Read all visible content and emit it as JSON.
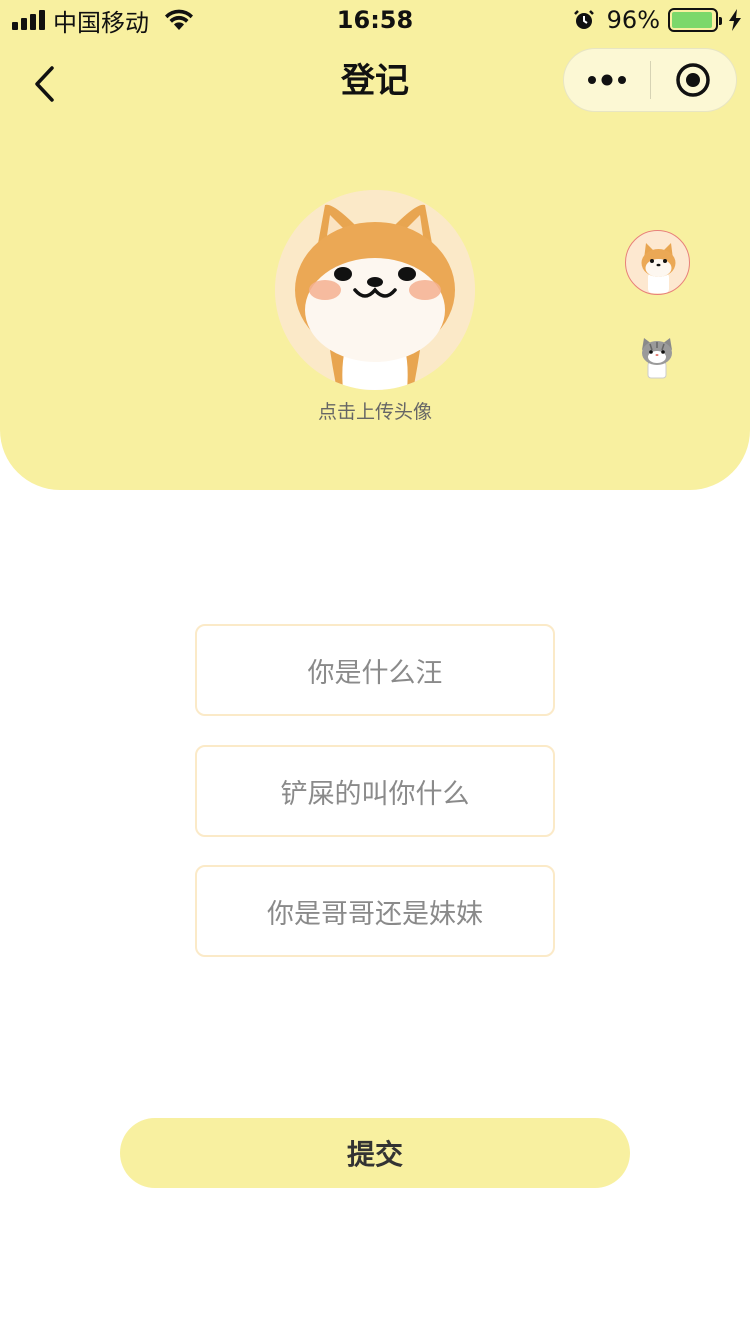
{
  "status_bar": {
    "carrier": "中国移动",
    "time": "16:58",
    "battery_percent": "96%",
    "battery_level": 0.96,
    "battery_color": "#7bd86b"
  },
  "nav": {
    "title": "登记"
  },
  "avatar": {
    "upload_label": "点击上传头像"
  },
  "form": {
    "breed_placeholder": "你是什么汪",
    "nickname_placeholder": "铲屎的叫你什么",
    "gender_placeholder": "你是哥哥还是妹妹"
  },
  "submit_label": "提交",
  "colors": {
    "header_bg": "#f8f0a0",
    "field_border": "#fbeac8",
    "avatar_selected_border": "#e8807a"
  }
}
